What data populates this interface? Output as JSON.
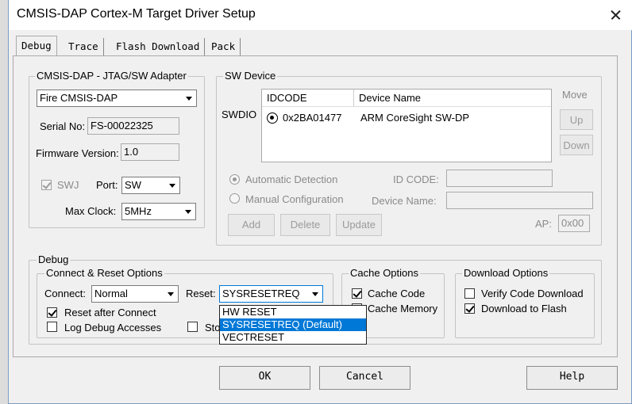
{
  "window": {
    "title": "CMSIS-DAP Cortex-M Target Driver Setup"
  },
  "tabs": [
    "Debug",
    "Trace",
    "Flash Download",
    "Pack"
  ],
  "adapter": {
    "legend": "CMSIS-DAP - JTAG/SW Adapter",
    "selected": "Fire CMSIS-DAP",
    "serial_label": "Serial No:",
    "serial_value": "FS-00022325",
    "firmware_label": "Firmware Version:",
    "firmware_value": "1.0",
    "swj_label": "SWJ",
    "port_label": "Port:",
    "port_value": "SW",
    "maxclock_label": "Max Clock:",
    "maxclock_value": "5MHz"
  },
  "sw_device": {
    "legend": "SW Device",
    "swdio_label": "SWDIO",
    "col_idcode": "IDCODE",
    "col_device": "Device Name",
    "row_idcode": "0x2BA01477",
    "row_device": "ARM CoreSight SW-DP",
    "move_label": "Move",
    "up_label": "Up",
    "down_label": "Down",
    "auto_detect": "Automatic Detection",
    "manual_config": "Manual Configuration",
    "idcode_label": "ID CODE:",
    "devname_label": "Device Name:",
    "add_label": "Add",
    "delete_label": "Delete",
    "update_label": "Update",
    "ap_label": "AP:",
    "ap_value": "0x00"
  },
  "debug": {
    "legend": "Debug",
    "connect_reset_legend": "Connect & Reset Options",
    "connect_label": "Connect:",
    "connect_value": "Normal",
    "reset_label": "Reset:",
    "reset_value": "SYSRESETREQ",
    "reset_after_connect": "Reset after Connect",
    "log_debug_accesses": "Log Debug Accesses",
    "stop_partial": "Sto",
    "reset_options": [
      "HW RESET",
      "SYSRESETREQ (Default)",
      "VECTRESET"
    ],
    "cache_legend": "Cache Options",
    "cache_code": "Cache Code",
    "cache_memory": "Cache Memory",
    "download_legend": "Download Options",
    "verify_code": "Verify Code Download",
    "download_flash": "Download to Flash"
  },
  "footer": {
    "ok": "OK",
    "cancel": "Cancel",
    "help": "Help"
  }
}
